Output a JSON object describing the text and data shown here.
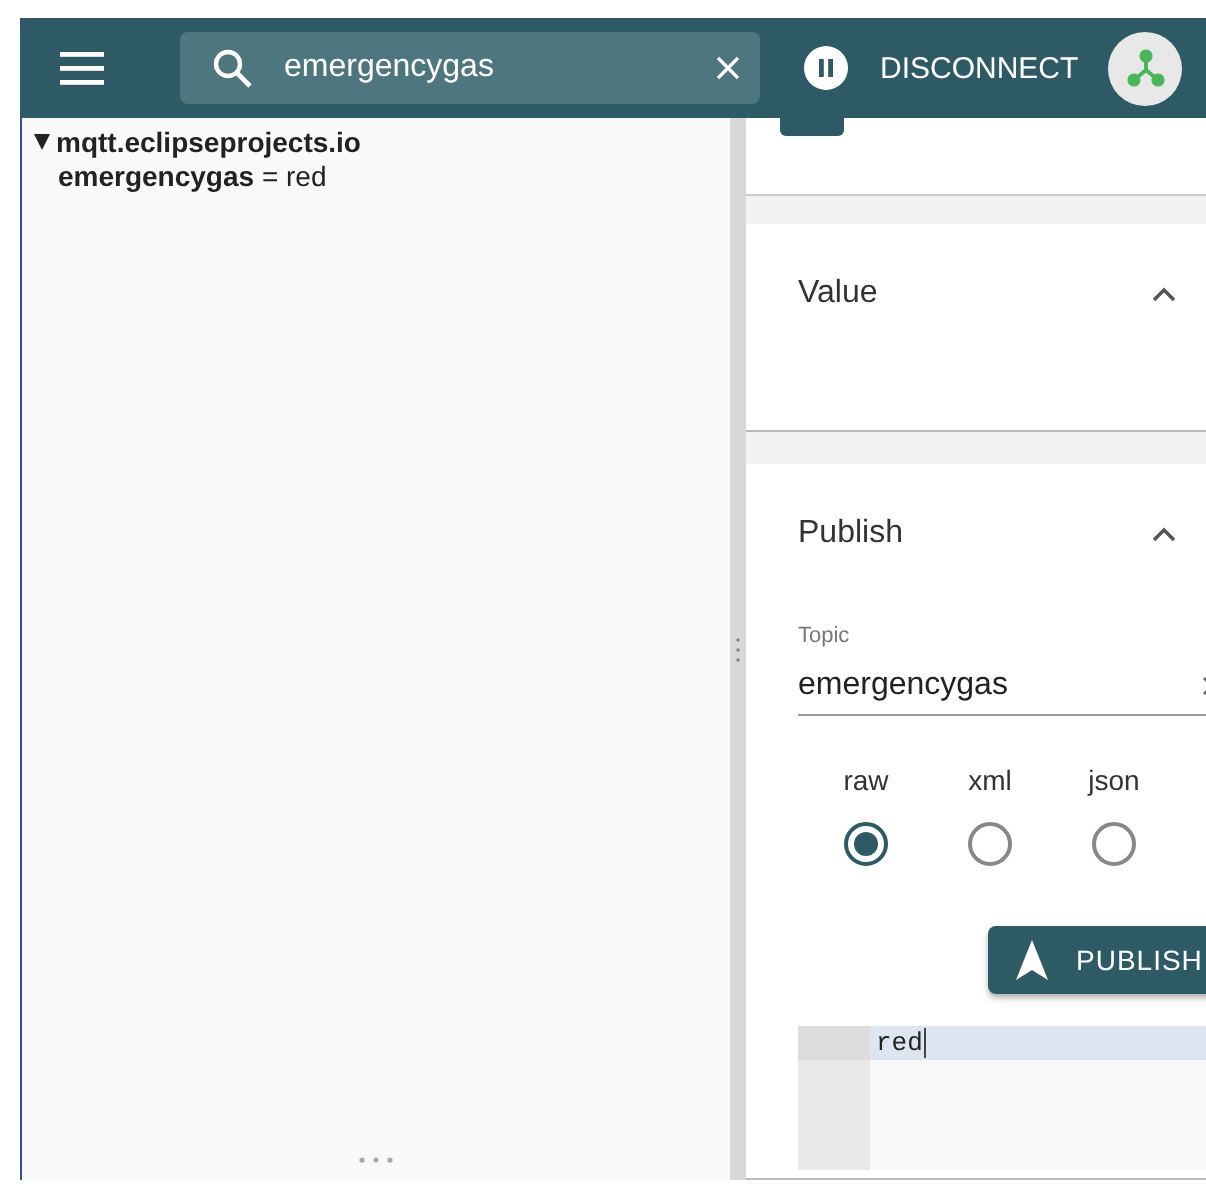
{
  "header": {
    "search": {
      "value": "emergencygas"
    },
    "connection_button": "DISCONNECT"
  },
  "tree": {
    "label": "mqtt.eclipseprojects.io",
    "expanded": true,
    "children": [
      {
        "text": "**emergencygas** = red"
      }
    ]
  },
  "panels": [
    {
      "title": "Value",
      "expanded": true
    },
    {
      "title": "Publish",
      "expanded": true
    }
  ],
  "publish": {
    "topic_label": "Topic",
    "topic": "emergencygas",
    "formats": [
      {
        "label": "raw",
        "selected": true
      },
      {
        "label": "xml",
        "selected": false
      },
      {
        "label": "json",
        "selected": false
      }
    ],
    "button": "PUBLISH",
    "editor_lines": [
      "red"
    ]
  }
}
